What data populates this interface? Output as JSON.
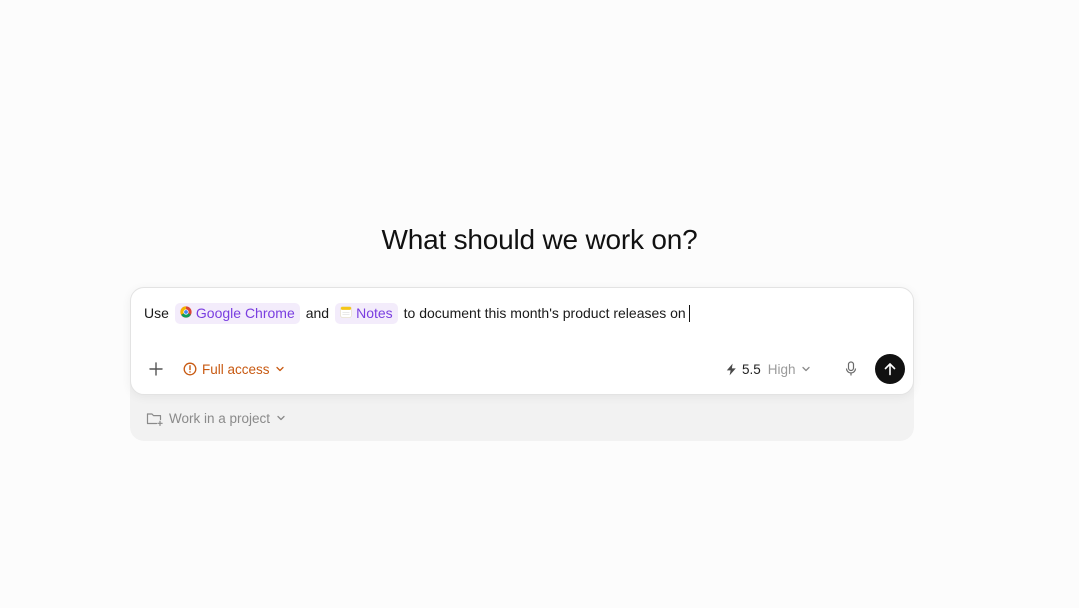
{
  "heading": "What should we work on?",
  "composer": {
    "prompt": {
      "prefix": "Use",
      "app1": {
        "name": "Google Chrome",
        "icon": "chrome-icon"
      },
      "connector": "and",
      "app2": {
        "name": "Notes",
        "icon": "notes-icon"
      },
      "suffix": "to document this month's product releases on"
    },
    "toolbar": {
      "add_icon": "plus-icon",
      "access": {
        "label": "Full access",
        "icon": "alert-circle-icon",
        "color": "#c85a12"
      },
      "model": {
        "icon": "lightning-icon",
        "version": "5.5",
        "level": "High"
      },
      "mic_icon": "microphone-icon",
      "send_icon": "arrow-up-icon"
    }
  },
  "project": {
    "label": "Work in a project",
    "icon": "folder-plus-icon"
  },
  "colors": {
    "chip_background": "#f3ecfb",
    "chip_text": "#7a3ee0",
    "send_button": "#111111",
    "page_background": "#fcfcfc"
  }
}
